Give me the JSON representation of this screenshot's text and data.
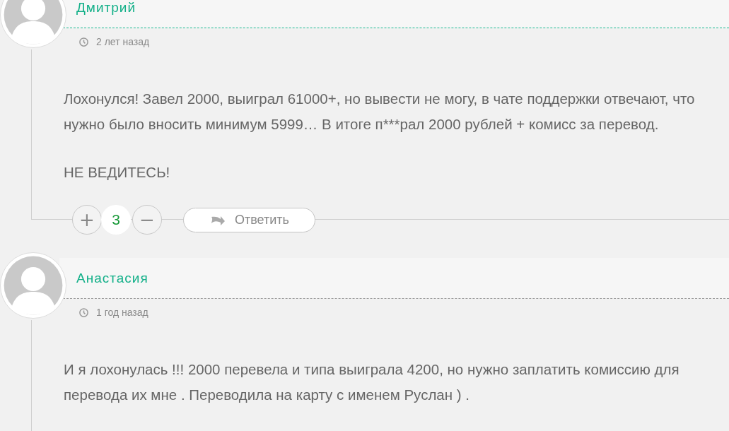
{
  "comments": [
    {
      "author": "Дмитрий",
      "highlighted": true,
      "time": "2 лет назад",
      "paragraphs": [
        "Лохонулся! Завел 2000, выиграл 61000+, но вывести не могу, в чате поддержки отвечают, что нужно было вносить минимум 5999… В итоге п***рал 2000 рублей + комисс за перевод.",
        "НЕ ВЕДИТЕСЬ!"
      ],
      "votes": {
        "plus": "+",
        "count": "3",
        "minus": "−"
      },
      "reply": "Ответить"
    },
    {
      "author": "Анастасия",
      "highlighted": false,
      "time": "1 год назад",
      "paragraphs": [
        "И я лохонулась !!! 2000 перевела и типа выиграла 4200, но нужно заплатить комиссию для перевода их мне . Переводила на карту с именем Руслан ) ."
      ]
    }
  ]
}
